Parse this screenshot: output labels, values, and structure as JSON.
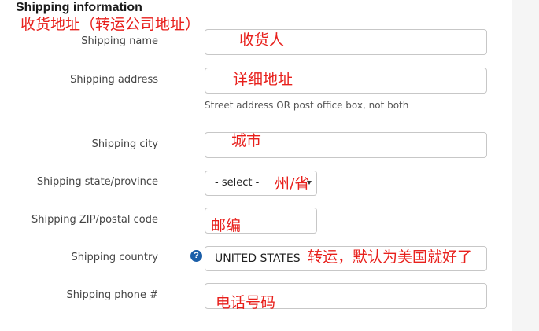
{
  "section": {
    "title": "Shipping information",
    "annotation": "收货地址（转运公司地址）"
  },
  "fields": {
    "name": {
      "label": "Shipping name",
      "annotation": "收货人"
    },
    "address": {
      "label": "Shipping address",
      "annotation": "详细地址",
      "help": "Street address OR post office box, not both"
    },
    "city": {
      "label": "Shipping city",
      "annotation": "城市"
    },
    "state": {
      "label": "Shipping state/province",
      "selected": "- select -",
      "annotation": "州/省"
    },
    "zip": {
      "label": "Shipping ZIP/postal code",
      "annotation": "邮编"
    },
    "country": {
      "label": "Shipping country",
      "help_icon": "question-circle-icon",
      "help_icon_glyph": "?",
      "selected": "UNITED STATES",
      "annotation": "转运，默认为美国就好了"
    },
    "phone": {
      "label": "Shipping phone #",
      "annotation": "电话号码"
    }
  },
  "colors": {
    "annotation": "#e8201c",
    "help_icon": "#1a5ea8",
    "border": "#c7c7c7"
  }
}
